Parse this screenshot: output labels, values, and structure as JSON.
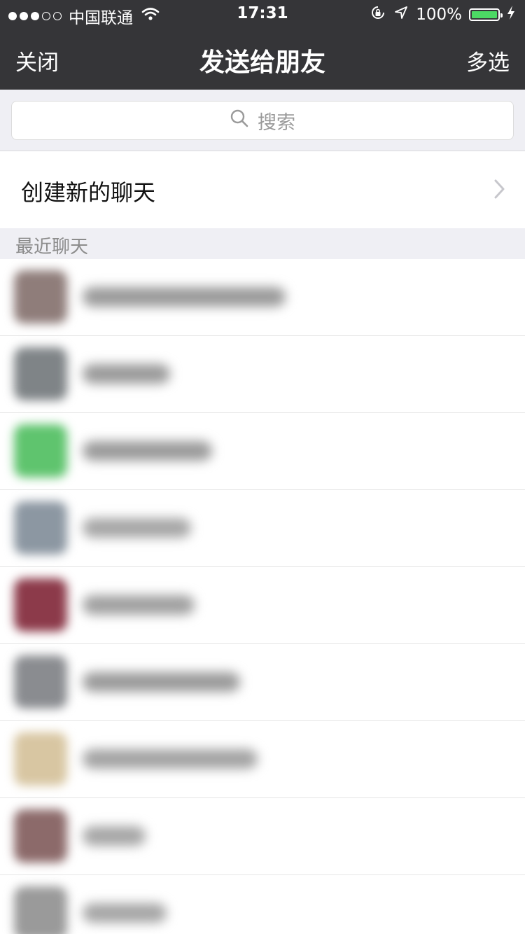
{
  "status_bar": {
    "carrier": "中国联通",
    "time": "17:31",
    "battery": "100%",
    "battery_color": "#4cd964",
    "icons": [
      "wifi-icon",
      "orientation-lock-icon",
      "location-icon",
      "battery-icon",
      "charging-icon"
    ]
  },
  "nav": {
    "left": "关闭",
    "title": "发送给朋友",
    "right": "多选"
  },
  "search": {
    "placeholder": "搜索",
    "icon": "search-icon"
  },
  "create_chat": {
    "label": "创建新的聊天",
    "icon": "chevron-right-icon"
  },
  "section": {
    "label": "最近聊天"
  },
  "chats": [
    {
      "avatar_color": "#8f7d7a",
      "name_width": 290,
      "name_color": "#9a9a9a"
    },
    {
      "avatar_color": "#7f8487",
      "name_width": 125,
      "name_color": "#9a9a9a"
    },
    {
      "avatar_color": "#5fc46e",
      "name_width": 185,
      "name_color": "#9a9a9a"
    },
    {
      "avatar_color": "#8c97a2",
      "name_width": 155,
      "name_color": "#a6a6a6"
    },
    {
      "avatar_color": "#8c3a4a",
      "name_width": 160,
      "name_color": "#a0a0a0"
    },
    {
      "avatar_color": "#8a8c90",
      "name_width": 225,
      "name_color": "#9a9a9a"
    },
    {
      "avatar_color": "#d8c6a2",
      "name_width": 250,
      "name_color": "#a3a3a3"
    },
    {
      "avatar_color": "#8c6a6a",
      "name_width": 90,
      "name_color": "#a6a6a6"
    },
    {
      "avatar_color": "#9a9a9a",
      "name_width": 120,
      "name_color": "#a6a6a6"
    }
  ]
}
